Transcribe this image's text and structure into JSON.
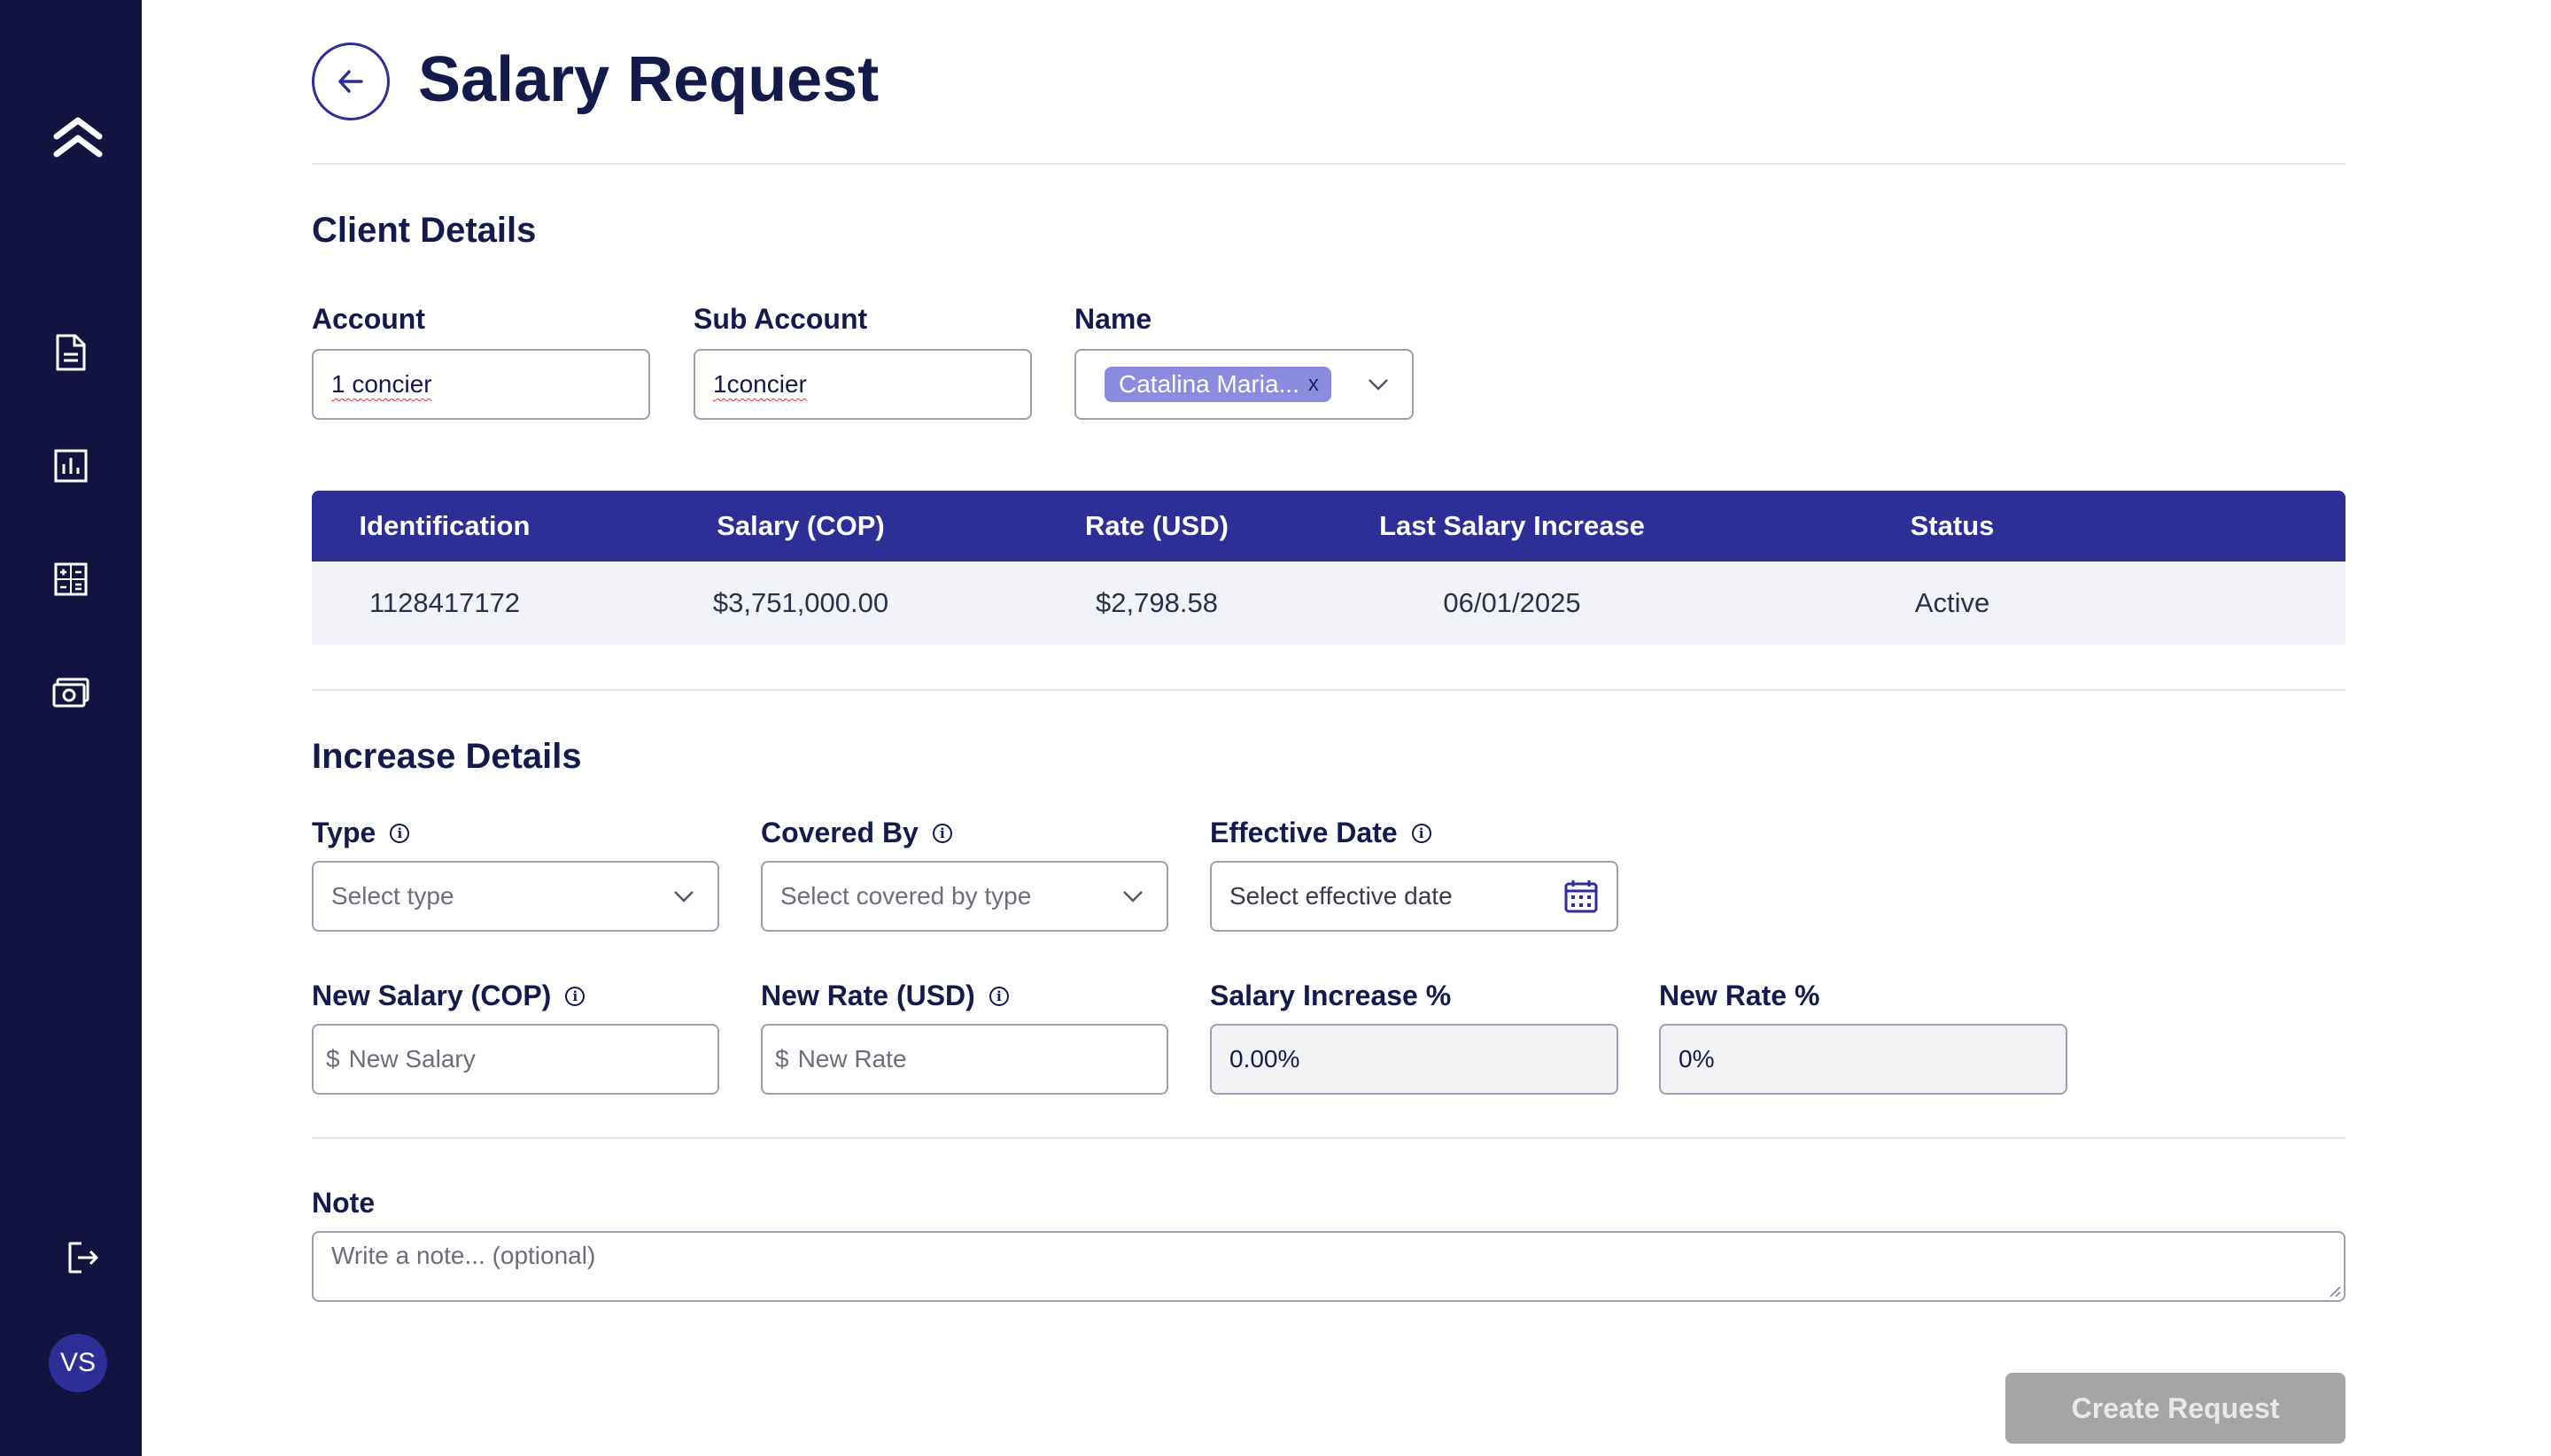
{
  "sidebar": {
    "logo_icon": "double-chevron-up-icon",
    "nav_icons": [
      "document-icon",
      "bar-chart-icon",
      "calculator-icon",
      "money-icon"
    ],
    "logout_icon": "logout-icon",
    "avatar_initials": "VS"
  },
  "header": {
    "back_icon": "arrow-left-icon",
    "title": "Salary Request"
  },
  "client_details": {
    "title": "Client Details",
    "account_label": "Account",
    "account_value": "1 concier",
    "sub_account_label": "Sub Account",
    "sub_account_value": "1concier",
    "name_label": "Name",
    "name_chip": "Catalina Maria...",
    "name_chip_remove": "x"
  },
  "table": {
    "headers": [
      "Identification",
      "Salary (COP)",
      "Rate (USD)",
      "Last Salary Increase",
      "Status"
    ],
    "rows": [
      [
        "1128417172",
        "$3,751,000.00",
        "$2,798.58",
        "06/01/2025",
        "Active"
      ]
    ]
  },
  "increase_details": {
    "title": "Increase Details",
    "type_label": "Type",
    "type_placeholder": "Select type",
    "covered_by_label": "Covered By",
    "covered_by_placeholder": "Select covered by type",
    "effective_date_label": "Effective Date",
    "effective_date_placeholder": "Select effective date",
    "new_salary_label": "New Salary (COP)",
    "new_salary_prefix": "$",
    "new_salary_placeholder": "New Salary",
    "new_rate_label": "New Rate (USD)",
    "new_rate_prefix": "$",
    "new_rate_placeholder": "New Rate",
    "salary_increase_label": "Salary Increase %",
    "salary_increase_value": "0.00%",
    "new_rate_pct_label": "New Rate %",
    "new_rate_pct_value": "0%"
  },
  "note": {
    "label": "Note",
    "placeholder": "Write a note... (optional)"
  },
  "actions": {
    "create_label": "Create Request"
  },
  "colors": {
    "sidebar_bg": "#12143f",
    "accent": "#2d2e96",
    "chip_bg": "#8b8ce0",
    "disabled_button": "#a5a5a8",
    "text_primary": "#151a4d"
  }
}
